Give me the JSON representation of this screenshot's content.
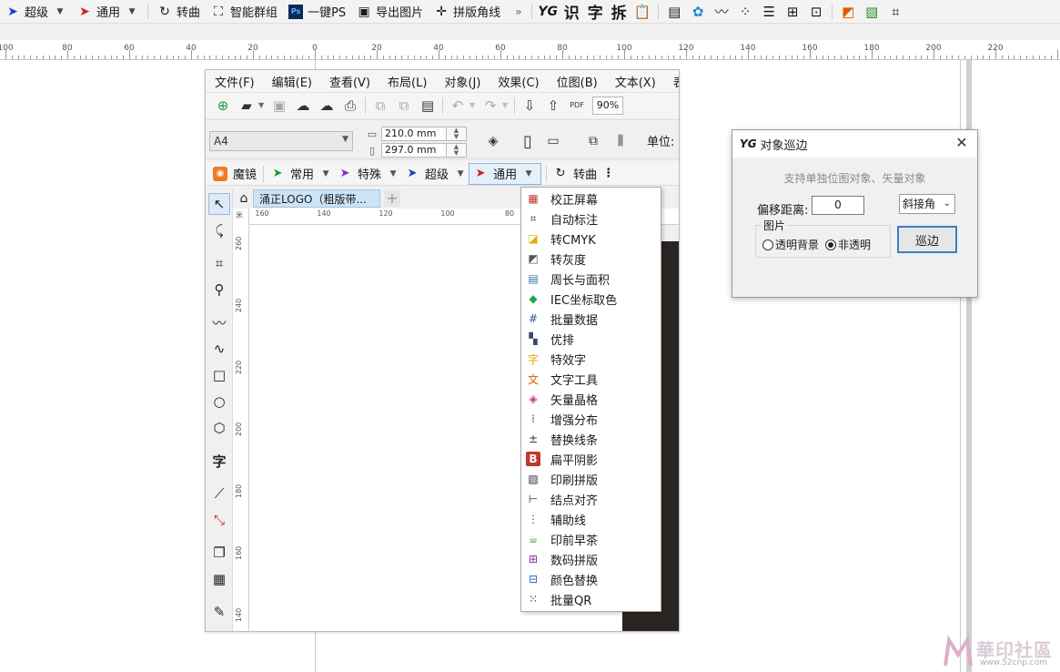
{
  "host_toolbar": {
    "items": [
      {
        "label": "超级",
        "icon": "paper-plane-blue-icon",
        "color": "#1a3fc9",
        "dropdown": true
      },
      {
        "label": "通用",
        "icon": "paper-plane-red-icon",
        "color": "#d42020",
        "dropdown": true
      },
      {
        "label": "转曲",
        "icon": "curve-convert-icon",
        "color": "#333333",
        "dropdown": false
      },
      {
        "label": "智能群组",
        "icon": "smart-group-icon",
        "color": "#333333",
        "dropdown": false
      },
      {
        "label": "一键PS",
        "icon": "photoshop-icon",
        "color": "#0b2a55",
        "dropdown": false
      },
      {
        "label": "导出图片",
        "icon": "image-export-icon",
        "color": "#333333",
        "dropdown": false
      },
      {
        "label": "拼版角线",
        "icon": "crop-marks-icon",
        "color": "#333333",
        "dropdown": false
      }
    ],
    "more": "»",
    "right_icons": [
      "YG",
      "识",
      "字",
      "拆"
    ]
  },
  "host_ruler": {
    "labels": [
      "100",
      "80",
      "60",
      "40",
      "20",
      "0",
      "20",
      "40",
      "60",
      "80",
      "100",
      "120",
      "140",
      "160",
      "180",
      "200",
      "220"
    ]
  },
  "inner_app": {
    "menubar": [
      "文件(F)",
      "编辑(E)",
      "查看(V)",
      "布局(L)",
      "对象(J)",
      "效果(C)",
      "位图(B)",
      "文本(X)",
      "表"
    ],
    "zoom": "90%",
    "pdf_label": "PDF",
    "page_size": "A4",
    "width": "210.0 mm",
    "height": "297.0 mm",
    "unit_label": "单位:",
    "plugin_bar": [
      {
        "label": "魔镜",
        "icon": "magic-mirror-icon",
        "dropdown": false
      },
      {
        "label": "常用",
        "icon": "paper-plane-green-icon",
        "dropdown": true
      },
      {
        "label": "特殊",
        "icon": "paper-plane-purple-icon",
        "dropdown": true
      },
      {
        "label": "超级",
        "icon": "paper-plane-blue-icon",
        "dropdown": true
      },
      {
        "label": "通用",
        "icon": "paper-plane-red-icon",
        "dropdown": true,
        "active": true
      },
      {
        "label": "转曲",
        "icon": "curve-convert-icon",
        "dropdown": false
      }
    ],
    "doc_tab": "涌正LOGO（粗版带...",
    "hruler_labels": [
      "160",
      "140",
      "120",
      "100",
      "80"
    ],
    "vruler_labels": [
      "260",
      "240",
      "220",
      "200",
      "180",
      "160",
      "140"
    ],
    "ruler_corner": "米"
  },
  "plugin_menu": {
    "items": [
      {
        "label": "校正屏幕",
        "icon": "calibrate-screen-icon",
        "color": "#c0392b"
      },
      {
        "label": "自动标注",
        "icon": "auto-dimension-icon",
        "color": "#333333"
      },
      {
        "label": "转CMYK",
        "icon": "cmyk-icon",
        "color": "#e0b000"
      },
      {
        "label": "转灰度",
        "icon": "grayscale-icon",
        "color": "#555555"
      },
      {
        "label": "周长与面积",
        "icon": "perimeter-area-icon",
        "color": "#2a7a9a"
      },
      {
        "label": "IEC坐标取色",
        "icon": "color-picker-icon",
        "color": "#1fa84a"
      },
      {
        "label": "批量数据",
        "icon": "batch-data-icon",
        "color": "#2a5a9a"
      },
      {
        "label": "优排",
        "icon": "layout-optimize-icon",
        "color": "#3a4a6a"
      },
      {
        "label": "特效字",
        "icon": "effect-text-icon",
        "color": "#e6a800"
      },
      {
        "label": "文字工具",
        "icon": "text-tool-icon",
        "color": "#e05a00"
      },
      {
        "label": "矢量晶格",
        "icon": "vector-lattice-icon",
        "color": "#c2358a"
      },
      {
        "label": "增强分布",
        "icon": "distribute-icon",
        "color": "#555555"
      },
      {
        "label": "替换线条",
        "icon": "replace-line-icon",
        "color": "#333333"
      },
      {
        "label": "扁平阴影",
        "icon": "flat-shadow-icon",
        "color": "#c0392b"
      },
      {
        "label": "印刷拼版",
        "icon": "imposition-icon",
        "color": "#333333"
      },
      {
        "label": "结点对齐",
        "icon": "node-align-icon",
        "color": "#333333"
      },
      {
        "label": "辅助线",
        "icon": "guideline-icon",
        "color": "#555555"
      },
      {
        "label": "印前早茶",
        "icon": "tea-cup-icon",
        "color": "#4a8a3a"
      },
      {
        "label": "数码拼版",
        "icon": "digital-imposition-icon",
        "color": "#8a2aa8"
      },
      {
        "label": "颜色替换",
        "icon": "color-replace-icon",
        "color": "#2a6ab8"
      },
      {
        "label": "批量QR",
        "icon": "qr-code-icon",
        "color": "#222222"
      }
    ]
  },
  "dialog": {
    "logo": "YG",
    "title": "对象巡边",
    "hint": "支持单独位图对象、矢量对象",
    "offset_label": "偏移距离:",
    "offset_value": "0",
    "join_value": "斜接角",
    "group_label": "图片",
    "radio_transparent": "透明背景",
    "radio_opaque": "非透明",
    "run_button": "巡边"
  },
  "watermark": {
    "text": "華印社區",
    "url": "www.52cnp.com"
  }
}
